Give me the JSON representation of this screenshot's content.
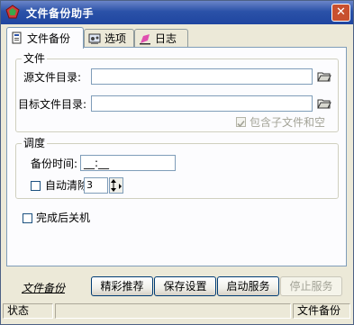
{
  "window": {
    "title": "文件备份助手",
    "close_glyph": "✕"
  },
  "tabs": [
    {
      "label": "文件备份",
      "icon": "file-backup-icon",
      "active": true
    },
    {
      "label": "选项",
      "icon": "options-icon",
      "active": false
    },
    {
      "label": "日志",
      "icon": "log-icon",
      "active": false
    }
  ],
  "file_group": {
    "legend": "文件",
    "source_label": "源文件目录:",
    "source_value": "",
    "target_label": "目标文件目录:",
    "target_value": "",
    "include_subfolders_label": "包含子文件和空",
    "include_subfolders_checked": true,
    "include_subfolders_enabled": false
  },
  "schedule_group": {
    "legend": "调度",
    "backup_time_label": "备份时间:",
    "backup_time_value": "__:__",
    "auto_clear_label": "自动清除",
    "auto_clear_checked": false,
    "auto_clear_value": "3"
  },
  "shutdown": {
    "label": "完成后关机",
    "checked": false
  },
  "bottom": {
    "link_text": "文件备份",
    "btn_recommend": "精彩推荐",
    "btn_save": "保存设置",
    "btn_start": "启动服务",
    "btn_stop": "停止服务"
  },
  "statusbar": {
    "left": "状态",
    "middle": "",
    "right": "文件备份"
  },
  "colors": {
    "titlebar": "#2b52a8",
    "close_button": "#c8502f",
    "window_bg": "#ece9d8",
    "panel_bg": "#fcfcfe",
    "disabled_text": "#a3a397"
  }
}
